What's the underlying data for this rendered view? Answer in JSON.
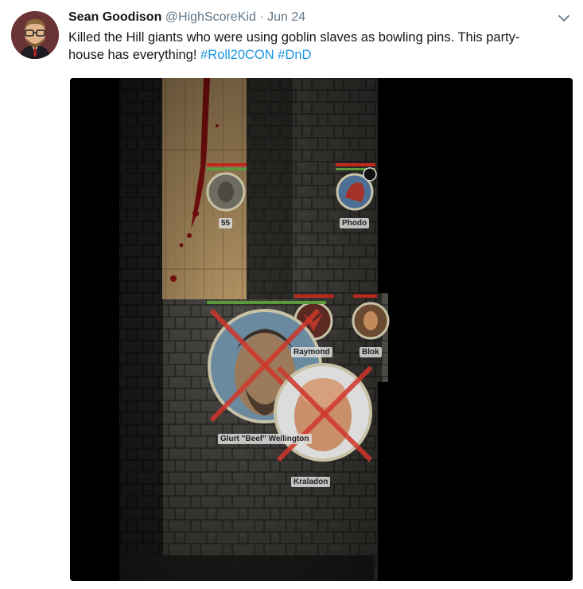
{
  "tweet": {
    "author_name": "Sean Goodison",
    "handle": "@HighScoreKid",
    "separator": "·",
    "date": "Jun 24",
    "text_main": "Killed the Hill giants who were using goblin slaves as bowling pins. This party-house has everything!",
    "hashtags": [
      "#Roll20CON",
      "#DnD"
    ]
  },
  "map": {
    "tokens": [
      {
        "label": "55"
      },
      {
        "label": "Phodo"
      },
      {
        "label": "Raymond"
      },
      {
        "label": "Blok"
      },
      {
        "label": "Glurt \"Beef\" Wellington"
      },
      {
        "label": "Kraladon"
      }
    ]
  },
  "icons": {
    "menu": "chevron-down-icon"
  },
  "colors": {
    "hashtag": "#1b95e0",
    "name": "#14171a",
    "meta": "#657786",
    "health_bar": "#c0281c",
    "aura_bar": "#5a9a3a",
    "kill_x": "#d0362a"
  }
}
